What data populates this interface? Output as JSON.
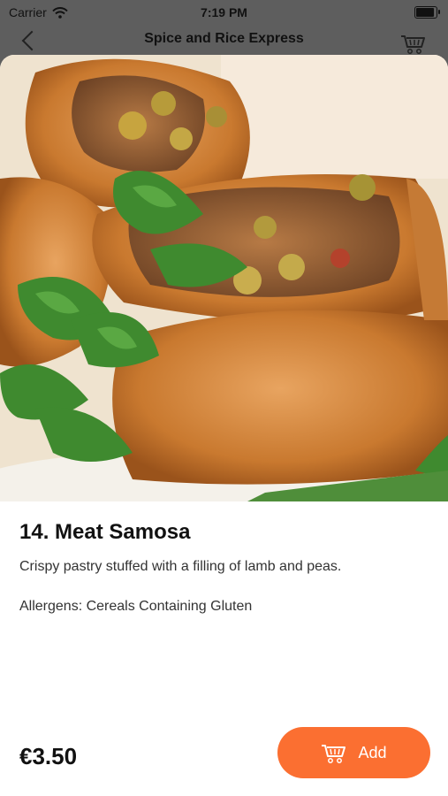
{
  "status_bar": {
    "carrier": "Carrier",
    "time": "7:19 PM"
  },
  "nav": {
    "title": "Spice and Rice Express",
    "back_icon": "chevron-left-icon",
    "cart_icon": "cart-icon"
  },
  "item": {
    "title": "14. Meat Samosa",
    "description": "Crispy pastry stuffed with a filling of lamb and peas.",
    "allergens": "Allergens: Cereals Containing Gluten",
    "price": "€3.50"
  },
  "actions": {
    "add_label": "Add"
  },
  "colors": {
    "accent": "#fb6f31",
    "overlay": "#5e5e5e"
  }
}
